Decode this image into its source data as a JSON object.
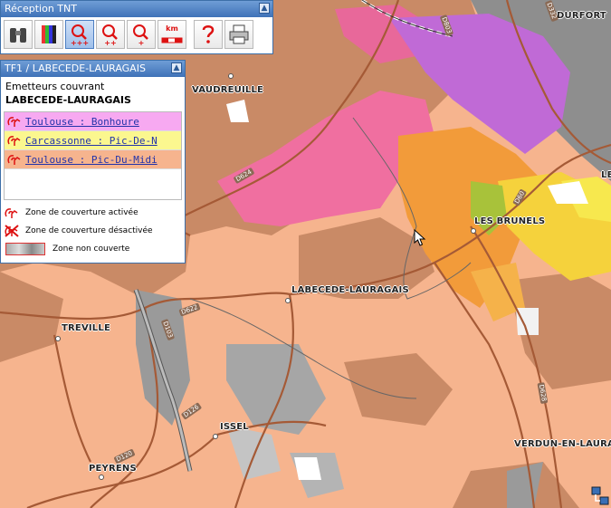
{
  "toolbar": {
    "title": "Réception TNT",
    "collapse_glyph": "▲",
    "tools": [
      {
        "name": "binoculars-icon"
      },
      {
        "name": "color-bars-icon"
      },
      {
        "name": "zoom-in-max-icon",
        "label": "+++",
        "active": true
      },
      {
        "name": "zoom-in-more-icon",
        "label": "++"
      },
      {
        "name": "zoom-in-icon",
        "label": "+"
      },
      {
        "name": "scale-km-icon",
        "label": "km"
      },
      {
        "name": "help-icon"
      },
      {
        "name": "print-icon"
      }
    ]
  },
  "info_panel": {
    "title": "TF1 / LABECEDE-LAURAGAIS",
    "subtitle": "Emetteurs couvrant",
    "commune": "LABECEDE-LAURAGAIS",
    "transmitters": [
      {
        "label": "Toulouse : Bonhoure",
        "color": "#f7a9f1"
      },
      {
        "label": "Carcassonne : Pic-De-N",
        "color": "#fbf78f"
      },
      {
        "label": "Toulouse : Pic-Du-Midi",
        "color": "#f6b48e"
      }
    ],
    "legend": {
      "active": "Zone de couverture activée",
      "inactive": "Zone de couverture désactivée",
      "uncovered": "Zone non couverte"
    }
  },
  "map": {
    "towns": [
      {
        "name": "DURFORT"
      },
      {
        "name": "VAUDREUILLE"
      },
      {
        "name": "LES BRUNELS"
      },
      {
        "name": "LABECEDE-LAURAGAIS"
      },
      {
        "name": "TREVILLE"
      },
      {
        "name": "ISSEL"
      },
      {
        "name": "PEYRENS"
      },
      {
        "name": "VERDUN-EN-LAURAG"
      },
      {
        "name": "LE"
      }
    ],
    "roads": [
      {
        "name": "D624"
      },
      {
        "name": "D622"
      },
      {
        "name": "D126"
      },
      {
        "name": "D103"
      },
      {
        "name": "D120"
      },
      {
        "name": "D628"
      },
      {
        "name": "D60"
      },
      {
        "name": "D803"
      },
      {
        "name": "D332"
      }
    ]
  }
}
